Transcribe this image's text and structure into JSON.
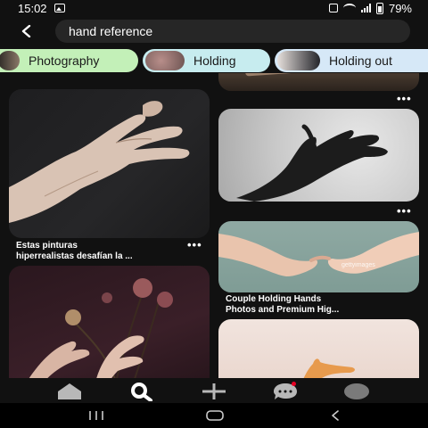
{
  "status_bar": {
    "time": "15:02",
    "battery": "79%"
  },
  "search": {
    "query": "hand reference"
  },
  "chips": [
    {
      "label": "Photography"
    },
    {
      "label": "Holding"
    },
    {
      "label": "Holding out"
    }
  ],
  "pins": {
    "hand1": {
      "title_line1": "Estas pinturas",
      "title_line2": "hiperrealistas desafían la ..."
    },
    "hand3": {
      "title_line1": "Couple Holding Hands",
      "title_line2": "Photos and Premium Hig...",
      "watermark": "gettyimages"
    }
  },
  "more_label": "•••",
  "nav": {
    "items": [
      "home-icon",
      "search-icon",
      "add-icon",
      "chat-icon",
      "profile-icon"
    ],
    "active": "search-icon",
    "notification_color": "#e60023"
  },
  "colors": {
    "background": "#111111",
    "search_box": "#262626",
    "chip_photography": "#c3f0b8",
    "chip_holding": "#c7ecef",
    "chip_holding_out": "#d6e8f7"
  }
}
